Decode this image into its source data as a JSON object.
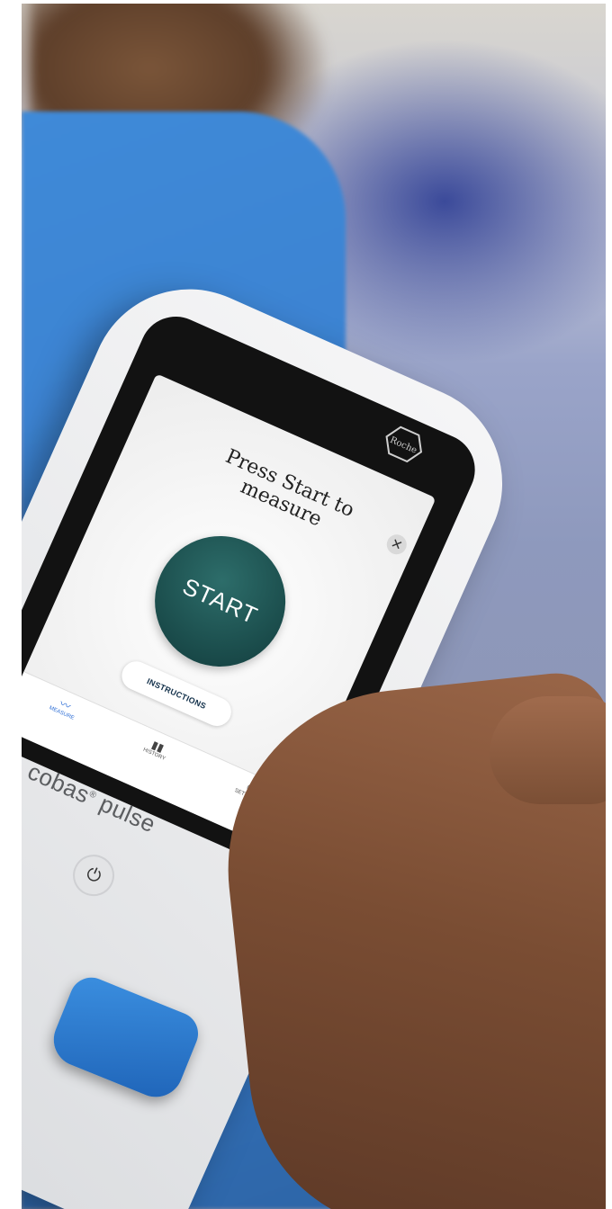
{
  "device": {
    "logo_text": "Roche",
    "headline": "Press Start to\nmeasure",
    "close_symbol": "✕",
    "start_label": "START",
    "instructions_label": "INSTRUCTIONS",
    "nav": [
      {
        "label": "MEASURE",
        "icon": "pulse-icon"
      },
      {
        "label": "HISTORY",
        "icon": "chart-icon"
      },
      {
        "label": "SETTINGS",
        "icon": "person-icon"
      }
    ],
    "brand_name": "cobas",
    "brand_mark": "®",
    "brand_product": "pulse",
    "power_symbol": "⏻"
  },
  "colors": {
    "start_button": "#1c4f4e",
    "scrub_blue": "#3c82d1",
    "cap_blue": "#2a76cc",
    "nav_active": "#2f6fd6"
  }
}
